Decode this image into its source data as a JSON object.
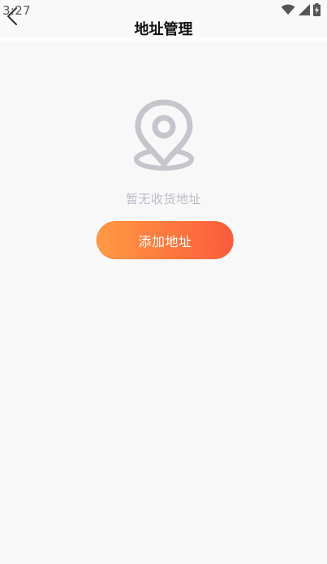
{
  "status_bar": {
    "time": "3:27"
  },
  "header": {
    "title": "地址管理"
  },
  "empty_state": {
    "message": "暂无收货地址"
  },
  "actions": {
    "add_address_label": "添加地址"
  },
  "colors": {
    "background": "#f8f8f8",
    "placeholder_icon": "#c4c6cc",
    "placeholder_text": "#b8bcc6",
    "button_gradient_start": "#ff9a42",
    "button_gradient_end": "#fb5b3c"
  },
  "icons": {
    "back": "chevron-left-icon",
    "wifi": "wifi-icon",
    "signal": "cellular-signal-icon",
    "battery": "battery-charging-icon",
    "empty_state": "location-pin-icon"
  }
}
